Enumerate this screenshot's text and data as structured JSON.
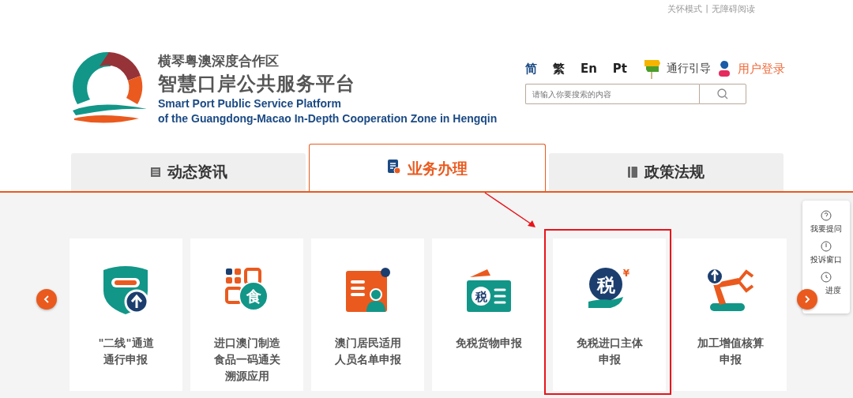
{
  "top_links": {
    "items": [
      "关怀模式",
      "无障碍阅读"
    ],
    "separator": "|"
  },
  "logo": {
    "title_cn": "横琴粤澳深度合作区",
    "subtitle_cn": "智慧口岸公共服务平台",
    "title_en": "Smart Port Public Service Platform",
    "subtitle_en": "of the Guangdong-Macao In-Depth Cooperation Zone in Hengqin"
  },
  "languages": [
    {
      "label": "简",
      "selected": true
    },
    {
      "label": "繁",
      "selected": false
    },
    {
      "label": "En",
      "selected": false
    },
    {
      "label": "Pt",
      "selected": false
    }
  ],
  "guide": "通行引导",
  "login": "用户登录",
  "search": {
    "placeholder": "请输入你要搜索的内容"
  },
  "tabs": [
    {
      "label": "动态资讯",
      "selected": false
    },
    {
      "label": "业务办理",
      "selected": true
    },
    {
      "label": "政策法规",
      "selected": false
    }
  ],
  "cards": [
    {
      "lines": [
        "\"二线\"通道",
        "通行申报"
      ],
      "highlighted": false
    },
    {
      "lines": [
        "进口澳门制造",
        "食品一码通关",
        "溯源应用"
      ],
      "icon_text": "食",
      "highlighted": false
    },
    {
      "lines": [
        "澳门居民适用",
        "人员名单申报"
      ],
      "highlighted": false
    },
    {
      "lines": [
        "免税货物申报"
      ],
      "icon_text": "税",
      "highlighted": false
    },
    {
      "lines": [
        "免税进口主体",
        "申报"
      ],
      "icon_text": "税",
      "icon_mark": "¥",
      "highlighted": true
    },
    {
      "lines": [
        "加工增值核算",
        "申报"
      ],
      "highlighted": false
    }
  ],
  "side_panel": [
    "我要提问",
    "投诉窗口",
    "进度"
  ]
}
